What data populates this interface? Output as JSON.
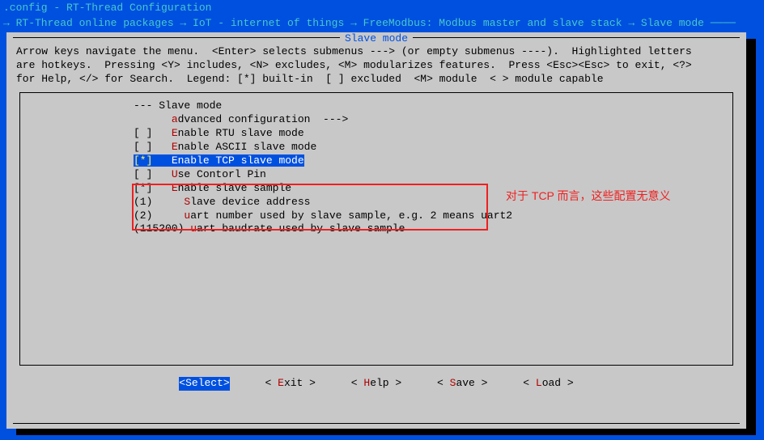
{
  "title_line": ".config - RT-Thread Configuration",
  "breadcrumb": "→ RT-Thread online packages → IoT - internet of things → FreeModbus: Modbus master and slave stack → Slave mode ────",
  "panel_title": " Slave mode ",
  "help": "Arrow keys navigate the menu.  <Enter> selects submenus ---> (or empty submenus ----).  Highlighted letters\nare hotkeys.  Pressing <Y> includes, <N> excludes, <M> modularizes features.  Press <Esc><Esc> to exit, <?>\nfor Help, </> for Search.  Legend: [*] built-in  [ ] excluded  <M> module  < > module capable",
  "menu": {
    "header": {
      "prefix": "--- ",
      "label": "Slave mode"
    },
    "adv": {
      "prefix": "      ",
      "hk": "a",
      "rest": "dvanced configuration  --->"
    },
    "rtu": {
      "prefix": "[ ]   ",
      "hk": "E",
      "rest": "nable RTU slave mode"
    },
    "ascii": {
      "prefix": "[ ]   ",
      "hk": "E",
      "rest": "nable ASCII slave mode"
    },
    "tcp": {
      "bracket": "[*]",
      "sp": "   ",
      "hk": "E",
      "rest": "nable TCP slave mode"
    },
    "pin": {
      "prefix": "[ ]   ",
      "hk": "U",
      "rest": "se Contorl Pin"
    },
    "sample": {
      "prefix": "[*]   ",
      "hk": "E",
      "rest": "nable slave sample"
    },
    "addr": {
      "prefix": "(1)     ",
      "hk": "S",
      "rest": "lave device address"
    },
    "uartn": {
      "prefix": "(2)     ",
      "hk": "u",
      "rest": "art number used by slave sample, e.g. 2 means uart2"
    },
    "baud": {
      "prefix": "(115200) ",
      "hk": "u",
      "rest": "art baudrate used by slave sample"
    }
  },
  "annotation": "对于 TCP 而言，这些配置无意义",
  "buttons": {
    "select": {
      "hk": "S",
      "rest": "elect"
    },
    "exit": {
      "hk": "E",
      "rest": "xit"
    },
    "help": {
      "hk": "H",
      "rest": "elp"
    },
    "save": {
      "hk": "S",
      "rest": "ave"
    },
    "load": {
      "hk": "L",
      "rest": "oad"
    }
  }
}
